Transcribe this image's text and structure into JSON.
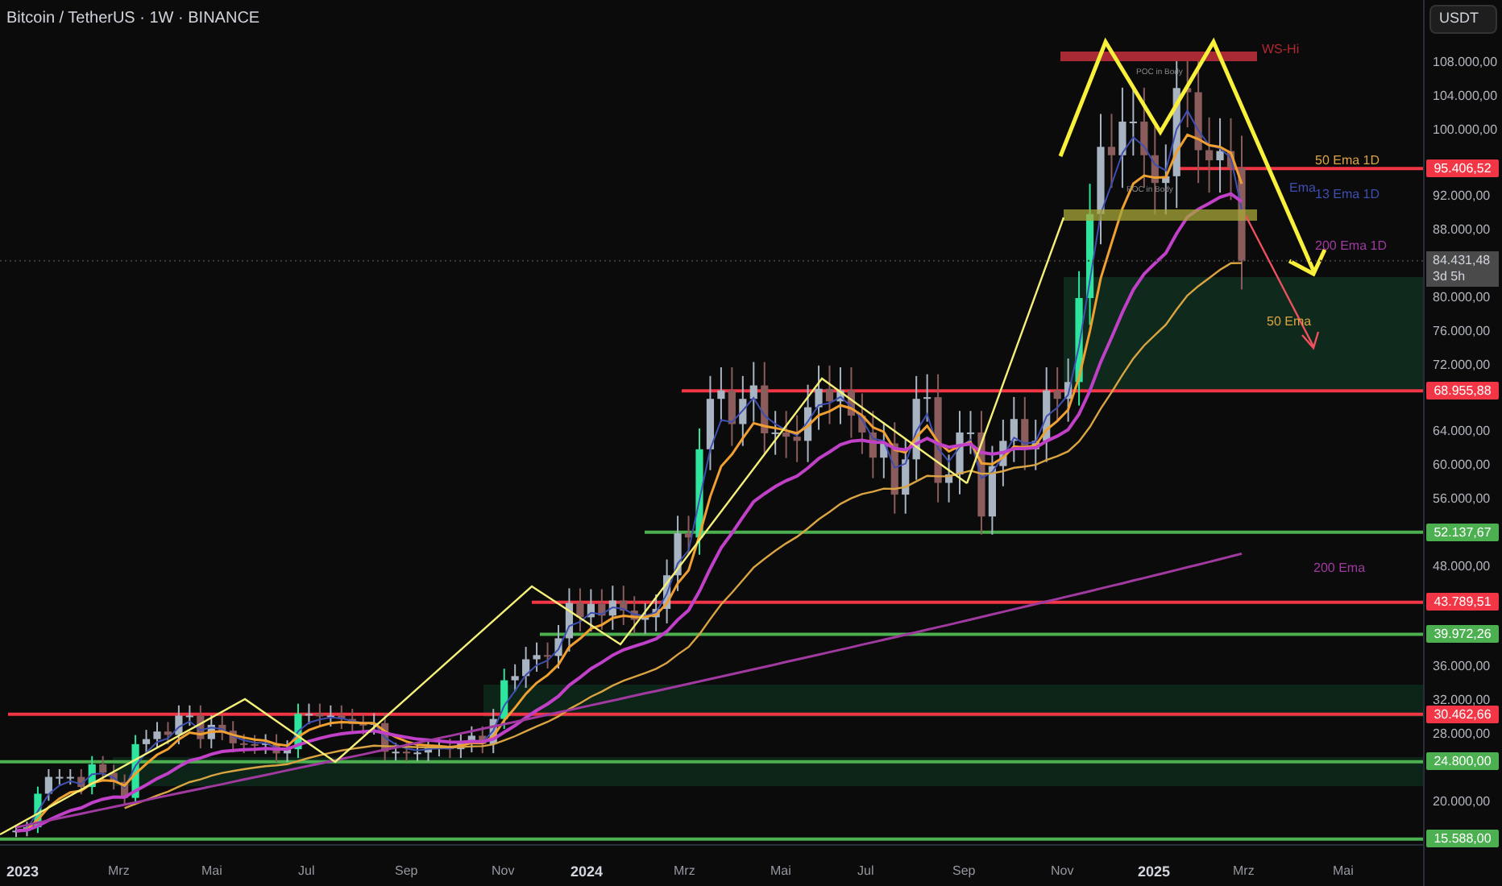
{
  "title": "Bitcoin / TetherUS · 1W · BINANCE",
  "currency_button": "USDT",
  "price_axis": [
    "108.000,00",
    "104.000,00",
    "100.000,00",
    "92.000,00",
    "88.000,00",
    "80.000,00",
    "76.000,00",
    "72.000,00",
    "64.000,00",
    "60.000,00",
    "56.000,00",
    "48.000,00",
    "36.000,00",
    "32.000,00",
    "28.000,00",
    "20.000,00"
  ],
  "levels": [
    {
      "label": "95.406,52",
      "color": "#f23645"
    },
    {
      "label": "68.955,88",
      "color": "#f23645"
    },
    {
      "label": "52.137,67",
      "color": "#4caf50"
    },
    {
      "label": "43.789,51",
      "color": "#f23645"
    },
    {
      "label": "39.972,26",
      "color": "#4caf50"
    },
    {
      "label": "30.462,66",
      "color": "#f23645"
    },
    {
      "label": "24.800,00",
      "color": "#4caf50"
    },
    {
      "label": "15.588,00",
      "color": "#4caf50"
    }
  ],
  "current_price": {
    "price": "84.431,48",
    "countdown": "3d 5h"
  },
  "annotations": [
    {
      "text": "WS-Hi",
      "color": "#b22833"
    },
    {
      "text": "POC in Body",
      "color": "#8a8a8a"
    },
    {
      "text": "POC in Body",
      "color": "#8a8a8a"
    },
    {
      "text": "50 Ema 1D",
      "color": "#d9a441"
    },
    {
      "text": "Ema",
      "color": "#3f4fb0"
    },
    {
      "text": "13 Ema 1D",
      "color": "#3f4fb0"
    },
    {
      "text": "200 Ema 1D",
      "color": "#a03aa0"
    },
    {
      "text": "50 Ema",
      "color": "#d9a441"
    },
    {
      "text": "200 Ema",
      "color": "#a03aa0"
    }
  ],
  "time_axis": [
    {
      "label": "2023",
      "kind": "year"
    },
    {
      "label": "Mrz",
      "kind": "month"
    },
    {
      "label": "Mai",
      "kind": "month"
    },
    {
      "label": "Jul",
      "kind": "month"
    },
    {
      "label": "Sep",
      "kind": "month"
    },
    {
      "label": "Nov",
      "kind": "month"
    },
    {
      "label": "2024",
      "kind": "year"
    },
    {
      "label": "Mrz",
      "kind": "month"
    },
    {
      "label": "Mai",
      "kind": "month"
    },
    {
      "label": "Jul",
      "kind": "month"
    },
    {
      "label": "Sep",
      "kind": "month"
    },
    {
      "label": "Nov",
      "kind": "month"
    },
    {
      "label": "2025",
      "kind": "year"
    },
    {
      "label": "Mrz",
      "kind": "month"
    },
    {
      "label": "Mai",
      "kind": "month"
    }
  ]
}
